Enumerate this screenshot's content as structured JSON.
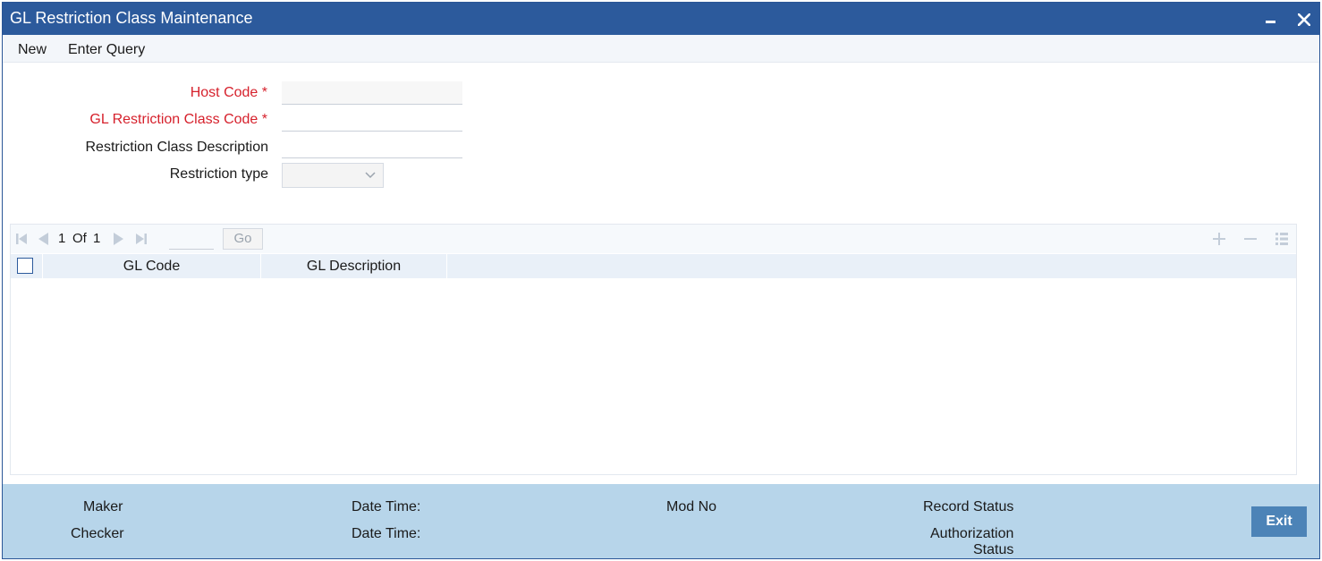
{
  "window": {
    "title": "GL Restriction Class Maintenance"
  },
  "menu": {
    "new_label": "New",
    "enter_query_label": "Enter Query"
  },
  "form": {
    "host_code_label": "Host Code",
    "gl_restriction_class_code_label": "GL Restriction Class Code",
    "restriction_class_description_label": "Restriction Class Description",
    "restriction_type_label": "Restriction type",
    "required_marker": "*",
    "host_code_value": "",
    "gl_restriction_class_code_value": "",
    "restriction_class_description_value": "",
    "restriction_type_value": ""
  },
  "grid": {
    "page_current": "1",
    "page_of": "Of",
    "page_total": "1",
    "go_label": "Go",
    "columns": [
      "GL Code",
      "GL Description"
    ],
    "rows": []
  },
  "footer": {
    "maker_label": "Maker",
    "checker_label": "Checker",
    "date_time_label_1": "Date Time:",
    "date_time_label_2": "Date Time:",
    "mod_no_label": "Mod No",
    "record_status_label": "Record Status",
    "authorization_label": "Authorization",
    "status_label": "Status",
    "exit_label": "Exit"
  },
  "colors": {
    "titlebar": "#2c5a9c",
    "required_text": "#d6212c",
    "footer_bg": "#b7d5ea",
    "exit_button": "#4c83b7"
  }
}
